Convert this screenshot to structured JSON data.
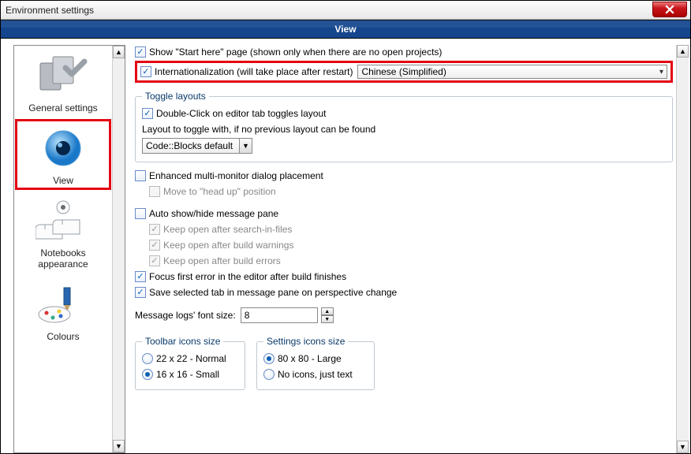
{
  "window": {
    "title": "Environment settings"
  },
  "header": {
    "title": "View"
  },
  "sidebar": {
    "items": [
      {
        "label": "General settings"
      },
      {
        "label": "View"
      },
      {
        "label": "Notebooks appearance"
      },
      {
        "label": "Colours"
      }
    ]
  },
  "main": {
    "show_start_here": {
      "label": "Show \"Start here\" page (shown only when there are no open projects)",
      "checked": true
    },
    "i18n": {
      "label": "Internationalization (will take place after restart)",
      "checked": true,
      "language": "Chinese (Simplified)"
    },
    "toggle_layouts": {
      "legend": "Toggle layouts",
      "double_click": {
        "label": "Double-Click on editor tab toggles layout",
        "checked": true
      },
      "layout_hint": "Layout to toggle with, if no previous layout can be found",
      "layout_select": "Code::Blocks default"
    },
    "multi_monitor": {
      "label": "Enhanced multi-monitor dialog placement",
      "checked": false
    },
    "head_up": {
      "label": "Move to \"head up\" position",
      "checked": false
    },
    "auto_hide": {
      "label": "Auto show/hide message pane",
      "checked": false
    },
    "keep_search": {
      "label": "Keep open after search-in-files",
      "checked": true
    },
    "keep_warn": {
      "label": "Keep open after build warnings",
      "checked": true
    },
    "keep_err": {
      "label": "Keep open after build errors",
      "checked": true
    },
    "focus_err": {
      "label": "Focus first error in the editor after build finishes",
      "checked": true
    },
    "save_tab": {
      "label": "Save selected tab in message pane on perspective change",
      "checked": true
    },
    "font_size": {
      "label": "Message logs' font size:",
      "value": "8"
    },
    "toolbar_icons": {
      "legend": "Toolbar icons size",
      "opt1": "22 x 22 - Normal",
      "opt2": "16 x 16 - Small",
      "selected": "opt2"
    },
    "settings_icons": {
      "legend": "Settings icons size",
      "opt1": "80 x 80 - Large",
      "opt2": "No icons, just text",
      "selected": "opt1"
    }
  }
}
